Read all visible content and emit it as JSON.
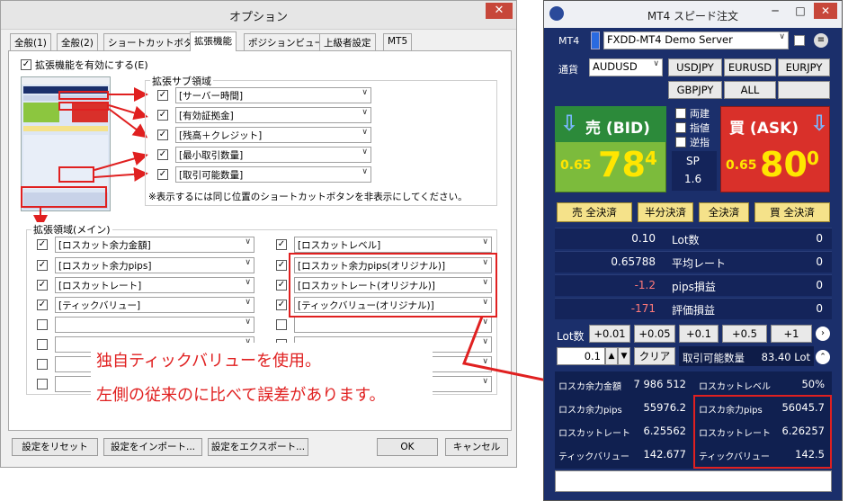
{
  "options": {
    "title": "オプション",
    "close": "✕",
    "tabs": [
      "全般(1)",
      "全般(2)",
      "ショートカットボタン",
      "拡張機能",
      "ポジションビュー",
      "上級者設定",
      "MT5"
    ],
    "enable_label": "拡張機能を有効にする(E)",
    "sub_region_label": "拡張サブ領域",
    "sub_items": [
      "[サーバー時間]",
      "[有効証拠金]",
      "[残高＋クレジット]",
      "[最小取引数量]",
      "[取引可能数量]"
    ],
    "note": "※表示するには同じ位置のショートカットボタンを非表示にしてください。",
    "main_region_label": "拡張領域(メイン)",
    "main_left": [
      "[ロスカット余力金額]",
      "[ロスカット余力pips]",
      "[ロスカットレート]",
      "[ティックバリュー]",
      "",
      "",
      "",
      ""
    ],
    "main_right": [
      "[ロスカットレベル]",
      "[ロスカット余力pips(オリジナル)]",
      "[ロスカットレート(オリジナル)]",
      "[ティックバリュー(オリジナル)]",
      "",
      "",
      "",
      ""
    ],
    "annotation_1": "独自ティックバリューを使用。",
    "annotation_2": "左側の従来のに比べて誤差があります。",
    "buttons": {
      "reset": "設定をリセット",
      "import": "設定をインポート...",
      "export": "設定をエクスポート...",
      "ok": "OK",
      "cancel": "キャンセル"
    }
  },
  "mt4": {
    "title": "MT4 スピード注文",
    "label": "MT4",
    "server": "FXDD-MT4 Demo Server",
    "currency_label": "通貨",
    "symbol": "AUDUSD",
    "pairs": [
      "USDJPY",
      "EURUSD",
      "EURJPY",
      "GBPJPY",
      "ALL",
      ""
    ],
    "sell_label": "売 (BID)",
    "buy_label": "買 (ASK)",
    "options_chk": [
      "両建",
      "指値",
      "逆指"
    ],
    "bid_prefix": "0.65",
    "bid_main": "78",
    "bid_small": "4",
    "ask_prefix": "0.65",
    "ask_main": "80",
    "ask_small": "0",
    "sp_label": "SP",
    "sp_value": "1.6",
    "close_buttons": [
      "売 全決済",
      "半分決済",
      "全決済",
      "買 全決済"
    ],
    "stats": [
      {
        "left": "0.10",
        "label": "Lot数",
        "right": "0",
        "neg": false
      },
      {
        "left": "0.65788",
        "label": "平均レート",
        "right": "0",
        "neg": false
      },
      {
        "left": "-1.2",
        "label": "pips損益",
        "right": "0",
        "neg": true
      },
      {
        "left": "-171",
        "label": "評価損益",
        "right": "0",
        "neg": true
      }
    ],
    "lot_label": "Lot数",
    "lot_buttons": [
      "+0.01",
      "+0.05",
      "+0.1",
      "+0.5",
      "+1"
    ],
    "lot_value": "0.1",
    "clear": "クリア",
    "tradable_label": "取引可能数量",
    "tradable_value": "83.40 Lot",
    "info": [
      {
        "l": "ロスカ余力金額",
        "lv": "7 986 512",
        "r": "ロスカットレベル",
        "rv": "50%"
      },
      {
        "l": "ロスカ余力pips",
        "lv": "55976.2",
        "r": "ロスカ余力pips",
        "rv": "56045.7"
      },
      {
        "l": "ロスカットレート",
        "lv": "6.25562",
        "r": "ロスカットレート",
        "rv": "6.26257"
      },
      {
        "l": "ティックバリュー",
        "lv": "142.677",
        "r": "ティックバリュー",
        "rv": "142.5"
      }
    ]
  }
}
